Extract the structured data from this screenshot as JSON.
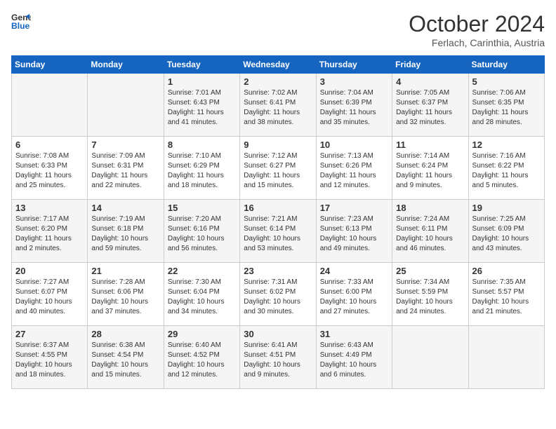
{
  "header": {
    "logo_line1": "General",
    "logo_line2": "Blue",
    "month_title": "October 2024",
    "subtitle": "Ferlach, Carinthia, Austria"
  },
  "days_of_week": [
    "Sunday",
    "Monday",
    "Tuesday",
    "Wednesday",
    "Thursday",
    "Friday",
    "Saturday"
  ],
  "weeks": [
    [
      {
        "day": "",
        "info": ""
      },
      {
        "day": "",
        "info": ""
      },
      {
        "day": "1",
        "info": "Sunrise: 7:01 AM\nSunset: 6:43 PM\nDaylight: 11 hours and 41 minutes."
      },
      {
        "day": "2",
        "info": "Sunrise: 7:02 AM\nSunset: 6:41 PM\nDaylight: 11 hours and 38 minutes."
      },
      {
        "day": "3",
        "info": "Sunrise: 7:04 AM\nSunset: 6:39 PM\nDaylight: 11 hours and 35 minutes."
      },
      {
        "day": "4",
        "info": "Sunrise: 7:05 AM\nSunset: 6:37 PM\nDaylight: 11 hours and 32 minutes."
      },
      {
        "day": "5",
        "info": "Sunrise: 7:06 AM\nSunset: 6:35 PM\nDaylight: 11 hours and 28 minutes."
      }
    ],
    [
      {
        "day": "6",
        "info": "Sunrise: 7:08 AM\nSunset: 6:33 PM\nDaylight: 11 hours and 25 minutes."
      },
      {
        "day": "7",
        "info": "Sunrise: 7:09 AM\nSunset: 6:31 PM\nDaylight: 11 hours and 22 minutes."
      },
      {
        "day": "8",
        "info": "Sunrise: 7:10 AM\nSunset: 6:29 PM\nDaylight: 11 hours and 18 minutes."
      },
      {
        "day": "9",
        "info": "Sunrise: 7:12 AM\nSunset: 6:27 PM\nDaylight: 11 hours and 15 minutes."
      },
      {
        "day": "10",
        "info": "Sunrise: 7:13 AM\nSunset: 6:26 PM\nDaylight: 11 hours and 12 minutes."
      },
      {
        "day": "11",
        "info": "Sunrise: 7:14 AM\nSunset: 6:24 PM\nDaylight: 11 hours and 9 minutes."
      },
      {
        "day": "12",
        "info": "Sunrise: 7:16 AM\nSunset: 6:22 PM\nDaylight: 11 hours and 5 minutes."
      }
    ],
    [
      {
        "day": "13",
        "info": "Sunrise: 7:17 AM\nSunset: 6:20 PM\nDaylight: 11 hours and 2 minutes."
      },
      {
        "day": "14",
        "info": "Sunrise: 7:19 AM\nSunset: 6:18 PM\nDaylight: 10 hours and 59 minutes."
      },
      {
        "day": "15",
        "info": "Sunrise: 7:20 AM\nSunset: 6:16 PM\nDaylight: 10 hours and 56 minutes."
      },
      {
        "day": "16",
        "info": "Sunrise: 7:21 AM\nSunset: 6:14 PM\nDaylight: 10 hours and 53 minutes."
      },
      {
        "day": "17",
        "info": "Sunrise: 7:23 AM\nSunset: 6:13 PM\nDaylight: 10 hours and 49 minutes."
      },
      {
        "day": "18",
        "info": "Sunrise: 7:24 AM\nSunset: 6:11 PM\nDaylight: 10 hours and 46 minutes."
      },
      {
        "day": "19",
        "info": "Sunrise: 7:25 AM\nSunset: 6:09 PM\nDaylight: 10 hours and 43 minutes."
      }
    ],
    [
      {
        "day": "20",
        "info": "Sunrise: 7:27 AM\nSunset: 6:07 PM\nDaylight: 10 hours and 40 minutes."
      },
      {
        "day": "21",
        "info": "Sunrise: 7:28 AM\nSunset: 6:06 PM\nDaylight: 10 hours and 37 minutes."
      },
      {
        "day": "22",
        "info": "Sunrise: 7:30 AM\nSunset: 6:04 PM\nDaylight: 10 hours and 34 minutes."
      },
      {
        "day": "23",
        "info": "Sunrise: 7:31 AM\nSunset: 6:02 PM\nDaylight: 10 hours and 30 minutes."
      },
      {
        "day": "24",
        "info": "Sunrise: 7:33 AM\nSunset: 6:00 PM\nDaylight: 10 hours and 27 minutes."
      },
      {
        "day": "25",
        "info": "Sunrise: 7:34 AM\nSunset: 5:59 PM\nDaylight: 10 hours and 24 minutes."
      },
      {
        "day": "26",
        "info": "Sunrise: 7:35 AM\nSunset: 5:57 PM\nDaylight: 10 hours and 21 minutes."
      }
    ],
    [
      {
        "day": "27",
        "info": "Sunrise: 6:37 AM\nSunset: 4:55 PM\nDaylight: 10 hours and 18 minutes."
      },
      {
        "day": "28",
        "info": "Sunrise: 6:38 AM\nSunset: 4:54 PM\nDaylight: 10 hours and 15 minutes."
      },
      {
        "day": "29",
        "info": "Sunrise: 6:40 AM\nSunset: 4:52 PM\nDaylight: 10 hours and 12 minutes."
      },
      {
        "day": "30",
        "info": "Sunrise: 6:41 AM\nSunset: 4:51 PM\nDaylight: 10 hours and 9 minutes."
      },
      {
        "day": "31",
        "info": "Sunrise: 6:43 AM\nSunset: 4:49 PM\nDaylight: 10 hours and 6 minutes."
      },
      {
        "day": "",
        "info": ""
      },
      {
        "day": "",
        "info": ""
      }
    ]
  ]
}
